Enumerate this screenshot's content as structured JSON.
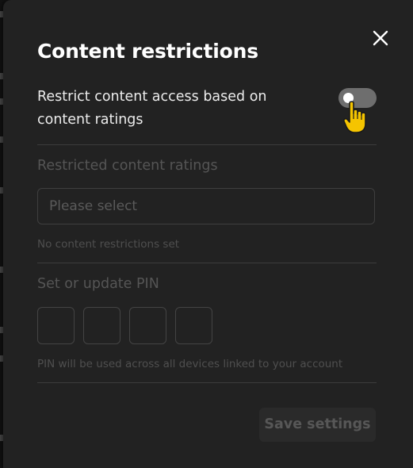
{
  "modal": {
    "title": "Content restrictions",
    "close_icon": "close-icon"
  },
  "toggle": {
    "label": "Restrict content access based on content ratings",
    "state": "off"
  },
  "ratings": {
    "heading": "Restricted content ratings",
    "select_value": "Please select",
    "helper": "No content restrictions set"
  },
  "pin": {
    "heading": "Set or update PIN",
    "digits": [
      "",
      "",
      "",
      ""
    ],
    "helper": "PIN will be used across all devices linked to your account"
  },
  "actions": {
    "save_label": "Save settings"
  },
  "cursor_icon": "hand-pointer-icon",
  "colors": {
    "modal_bg": "#222222",
    "cursor_yellow": "#f5c400",
    "toggle_off": "#6e6e6e"
  }
}
